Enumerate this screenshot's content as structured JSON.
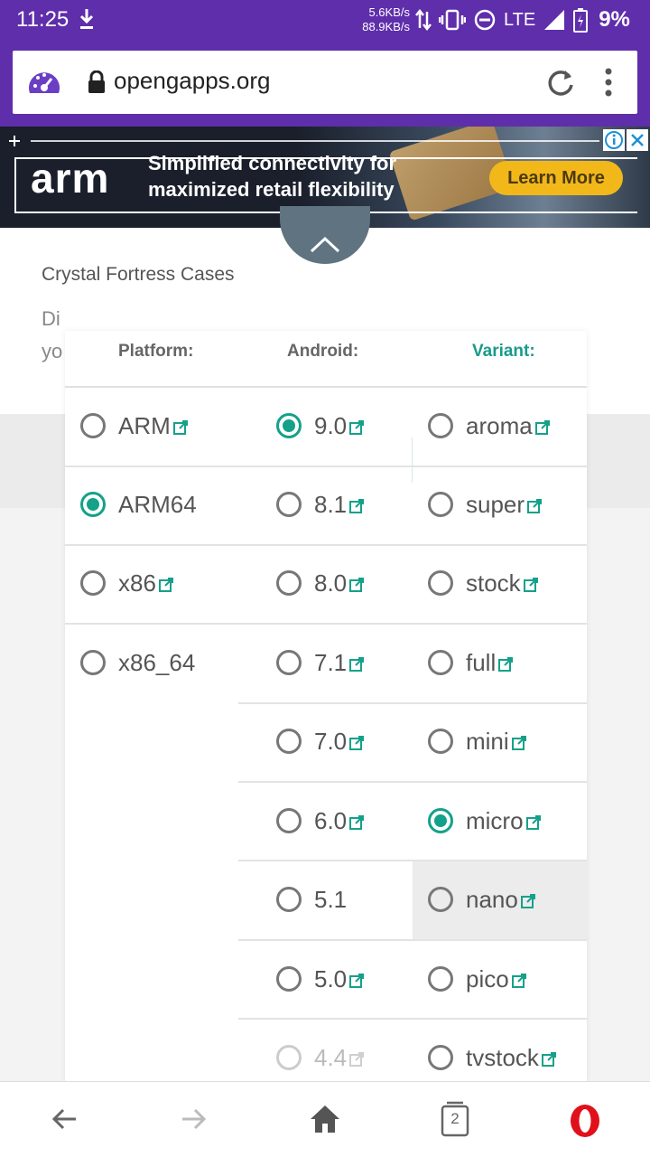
{
  "status_bar": {
    "time": "11:25",
    "speed_up": "5.6KB/s",
    "speed_down": "88.9KB/s",
    "network": "LTE",
    "battery": "9%"
  },
  "browser": {
    "url": "opengapps.org",
    "tab_count": "2"
  },
  "ad": {
    "brand": "arm",
    "line1": "Simplified connectivity for",
    "line2": "maximized retail flexibility",
    "cta": "Learn More"
  },
  "card": {
    "title": "Crystal Fortress Cases",
    "desc_fragment1": "Di",
    "desc_fragment2": "yo"
  },
  "selector": {
    "headers": {
      "platform": "Platform:",
      "android": "Android:",
      "variant": "Variant:"
    },
    "platform": [
      {
        "label": "ARM",
        "checked": false
      },
      {
        "label": "ARM64",
        "checked": true
      },
      {
        "label": "x86",
        "checked": false
      },
      {
        "label": "x86_64",
        "checked": false
      }
    ],
    "android": [
      {
        "label": "9.0",
        "checked": true
      },
      {
        "label": "8.1",
        "checked": false
      },
      {
        "label": "8.0",
        "checked": false
      },
      {
        "label": "7.1",
        "checked": false
      },
      {
        "label": "7.0",
        "checked": false
      },
      {
        "label": "6.0",
        "checked": false
      },
      {
        "label": "5.1",
        "checked": false
      },
      {
        "label": "5.0",
        "checked": false
      },
      {
        "label": "4.4",
        "checked": false,
        "disabled": true
      }
    ],
    "variant": [
      {
        "label": "aroma",
        "checked": false
      },
      {
        "label": "super",
        "checked": false
      },
      {
        "label": "stock",
        "checked": false
      },
      {
        "label": "full",
        "checked": false
      },
      {
        "label": "mini",
        "checked": false
      },
      {
        "label": "micro",
        "checked": true
      },
      {
        "label": "nano",
        "checked": false,
        "highlighted": true
      },
      {
        "label": "pico",
        "checked": false
      },
      {
        "label": "tvstock",
        "checked": false
      }
    ]
  },
  "colors": {
    "brand_purple": "#5f2eab",
    "accent_teal": "#14a18a",
    "ad_cta": "#f2b81a",
    "opera_red": "#e0111b"
  }
}
